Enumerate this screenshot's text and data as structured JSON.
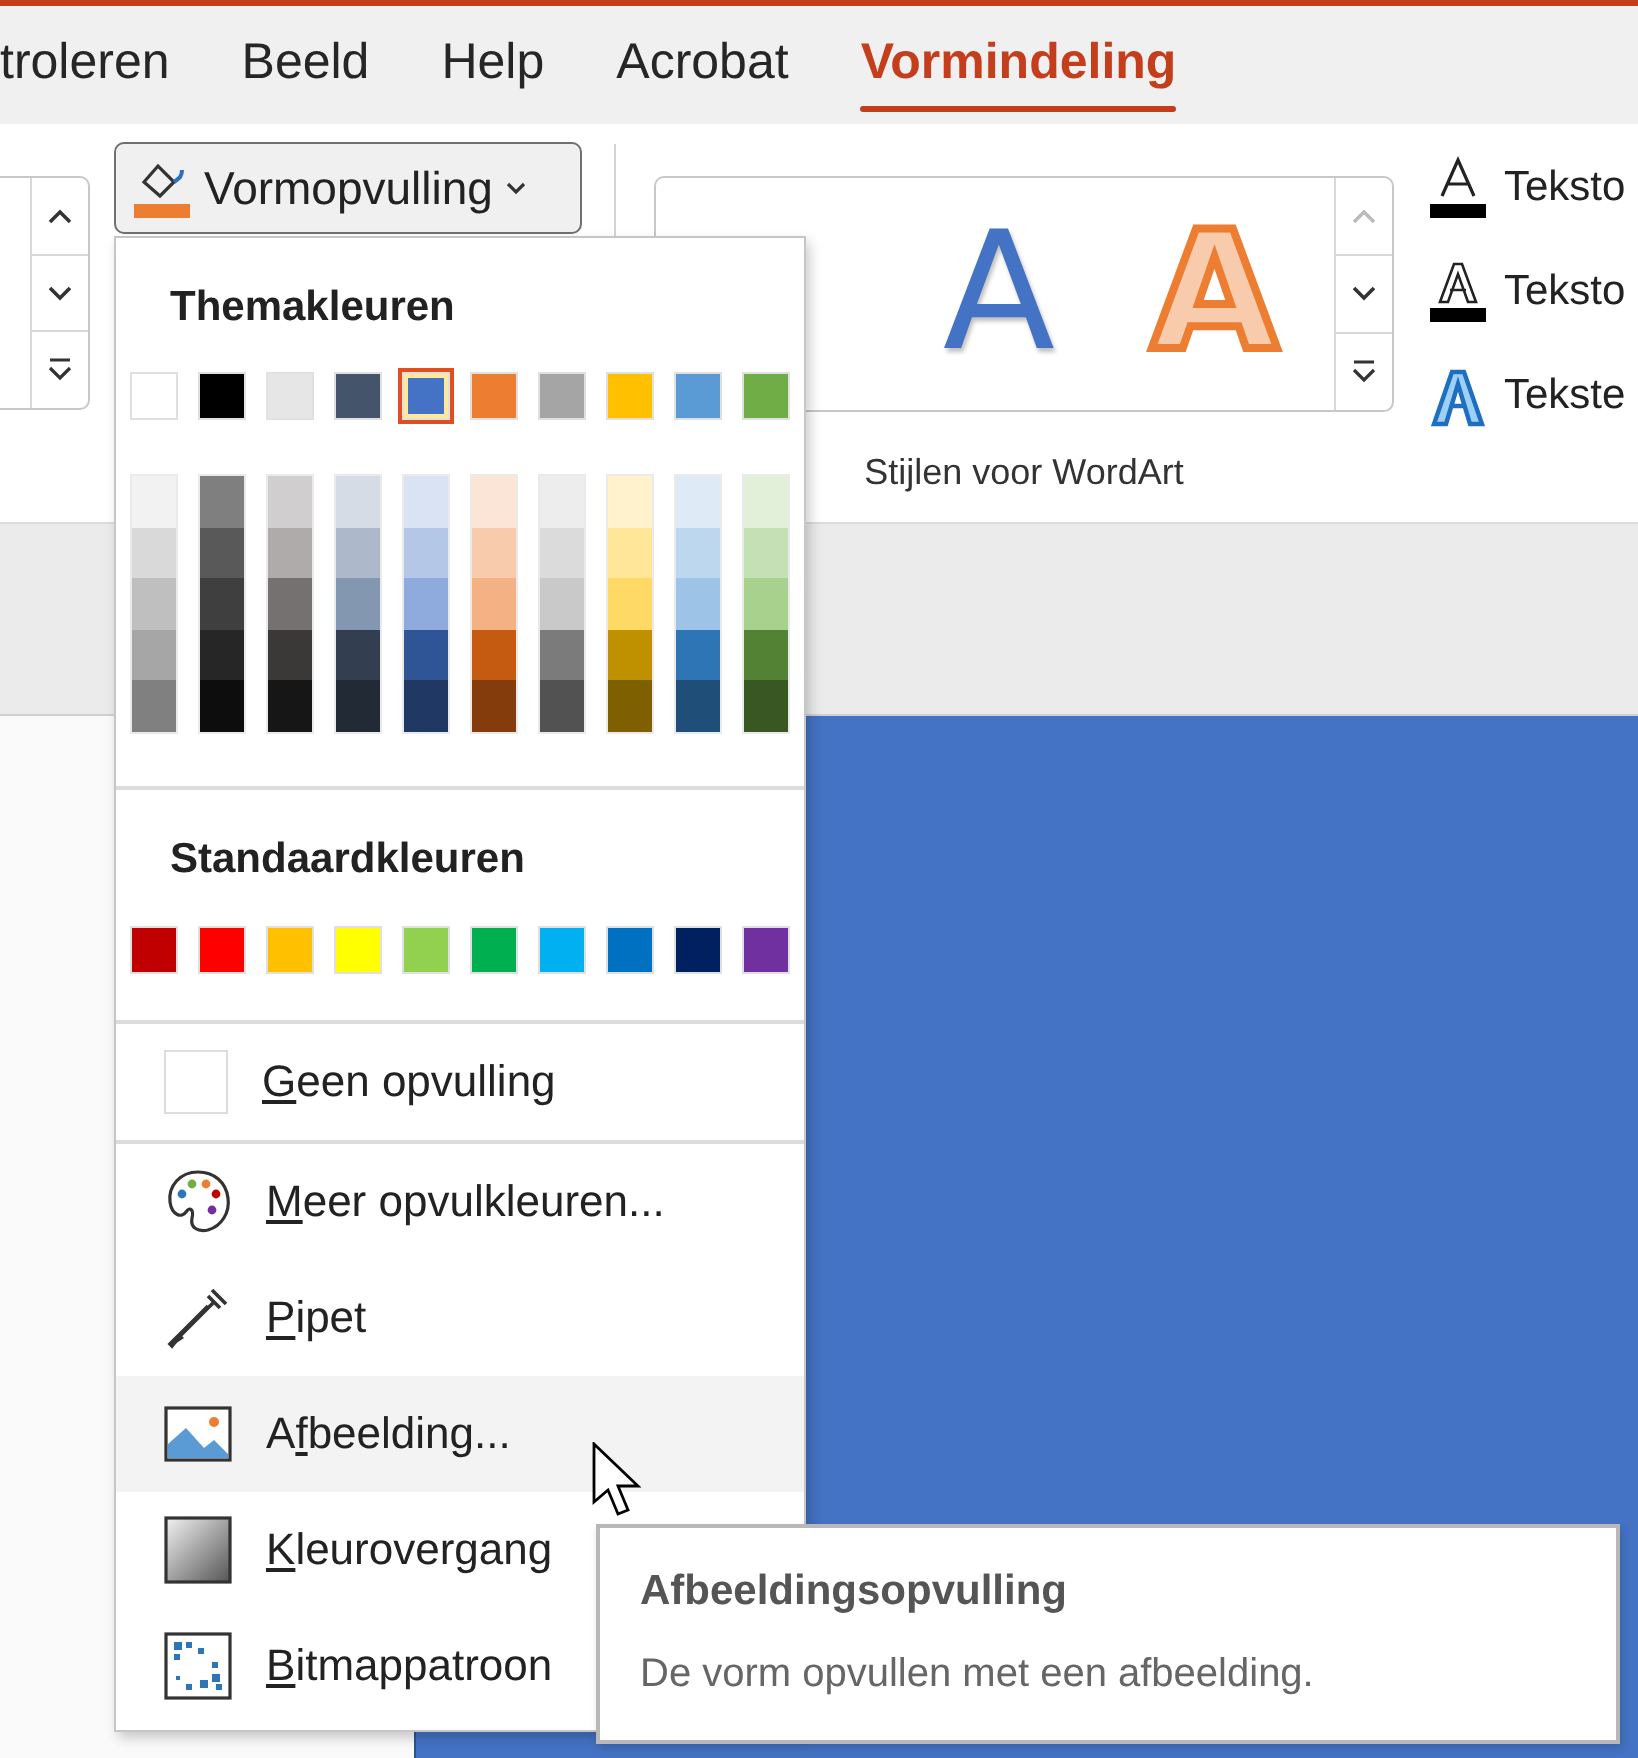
{
  "tabs": [
    {
      "label": "troleren",
      "selected": false
    },
    {
      "label": "Beeld",
      "selected": false
    },
    {
      "label": "Help",
      "selected": false
    },
    {
      "label": "Acrobat",
      "selected": false
    },
    {
      "label": "Vormindeling",
      "selected": true
    }
  ],
  "fill_button": {
    "label": "Vormopvulling"
  },
  "wordart_gallery": {
    "samples": [
      {
        "glyph": "A",
        "kind": "fill"
      },
      {
        "glyph": "A",
        "kind": "outline"
      }
    ],
    "label": "Stijlen voor WordArt"
  },
  "text_options": [
    {
      "label": "Teksto",
      "kind": "fill"
    },
    {
      "label": "Teksto",
      "kind": "outline"
    },
    {
      "label": "Tekste",
      "kind": "effects"
    }
  ],
  "fill_menu": {
    "theme_heading": "Themakleuren",
    "theme_colors": [
      {
        "color": "#ffffff",
        "selected": false
      },
      {
        "color": "#000000",
        "selected": false
      },
      {
        "color": "#e7e6e6",
        "selected": false
      },
      {
        "color": "#44546a",
        "selected": false
      },
      {
        "color": "#4472c4",
        "selected": true
      },
      {
        "color": "#ed7d31",
        "selected": false
      },
      {
        "color": "#a5a5a5",
        "selected": false
      },
      {
        "color": "#ffc000",
        "selected": false
      },
      {
        "color": "#5b9bd5",
        "selected": false
      },
      {
        "color": "#70ad47",
        "selected": false
      }
    ],
    "theme_shades": [
      {
        "shades": [
          {
            "color": "#f2f2f2"
          },
          {
            "color": "#d9d9d9"
          },
          {
            "color": "#bfbfbf"
          },
          {
            "color": "#a6a6a6"
          },
          {
            "color": "#808080"
          }
        ]
      },
      {
        "shades": [
          {
            "color": "#7f7f7f"
          },
          {
            "color": "#595959"
          },
          {
            "color": "#3f3f3f"
          },
          {
            "color": "#262626"
          },
          {
            "color": "#0d0d0d"
          }
        ]
      },
      {
        "shades": [
          {
            "color": "#d0cece"
          },
          {
            "color": "#afabab"
          },
          {
            "color": "#767171"
          },
          {
            "color": "#3b3838"
          },
          {
            "color": "#171616"
          }
        ]
      },
      {
        "shades": [
          {
            "color": "#d6dce5"
          },
          {
            "color": "#adb9ca"
          },
          {
            "color": "#8497b0"
          },
          {
            "color": "#333f50"
          },
          {
            "color": "#222a35"
          }
        ]
      },
      {
        "shades": [
          {
            "color": "#dae3f3"
          },
          {
            "color": "#b4c7e7"
          },
          {
            "color": "#8faadc"
          },
          {
            "color": "#2f5597"
          },
          {
            "color": "#203864"
          }
        ]
      },
      {
        "shades": [
          {
            "color": "#fbe5d6"
          },
          {
            "color": "#f8cbad"
          },
          {
            "color": "#f4b183"
          },
          {
            "color": "#c55a11"
          },
          {
            "color": "#843c0c"
          }
        ]
      },
      {
        "shades": [
          {
            "color": "#ededed"
          },
          {
            "color": "#dbdbdb"
          },
          {
            "color": "#c9c9c9"
          },
          {
            "color": "#7b7b7b"
          },
          {
            "color": "#525252"
          }
        ]
      },
      {
        "shades": [
          {
            "color": "#fff2cc"
          },
          {
            "color": "#ffe699"
          },
          {
            "color": "#ffd966"
          },
          {
            "color": "#bf9000"
          },
          {
            "color": "#7f6000"
          }
        ]
      },
      {
        "shades": [
          {
            "color": "#deebf7"
          },
          {
            "color": "#bdd7ee"
          },
          {
            "color": "#9dc3e6"
          },
          {
            "color": "#2e75b6"
          },
          {
            "color": "#1f4e79"
          }
        ]
      },
      {
        "shades": [
          {
            "color": "#e2f0d9"
          },
          {
            "color": "#c5e0b4"
          },
          {
            "color": "#a9d18e"
          },
          {
            "color": "#548235"
          },
          {
            "color": "#385723"
          }
        ]
      }
    ],
    "standard_heading": "Standaardkleuren",
    "standard_colors": [
      {
        "color": "#c00000"
      },
      {
        "color": "#ff0000"
      },
      {
        "color": "#ffc000"
      },
      {
        "color": "#ffff00"
      },
      {
        "color": "#92d050"
      },
      {
        "color": "#00b050"
      },
      {
        "color": "#00b0f0"
      },
      {
        "color": "#0070c0"
      },
      {
        "color": "#002060"
      },
      {
        "color": "#7030a0"
      }
    ],
    "items": [
      {
        "kind": "no-fill",
        "label_parts": {
          "key": "G",
          "rest": "een opvulling"
        },
        "highlighted": false
      },
      {
        "kind": "palette",
        "label_parts": {
          "key": "M",
          "rest": "eer opvulkleuren..."
        },
        "highlighted": false
      },
      {
        "kind": "eyedropper",
        "label_parts": {
          "key": "P",
          "rest": "ipet"
        },
        "highlighted": false
      },
      {
        "kind": "picture",
        "label_parts": {
          "start": "A",
          "key": "f",
          "rest": "beelding..."
        },
        "highlighted": true
      },
      {
        "kind": "gradient",
        "label_parts": {
          "key": "K",
          "rest": "leurovergang"
        },
        "highlighted": false
      },
      {
        "kind": "pattern",
        "label_parts": {
          "key": "B",
          "rest": "itmappatroon"
        },
        "highlighted": false
      }
    ]
  },
  "tooltip": {
    "title": "Afbeeldingsopvulling",
    "description": "De vorm opvullen met een afbeelding."
  }
}
